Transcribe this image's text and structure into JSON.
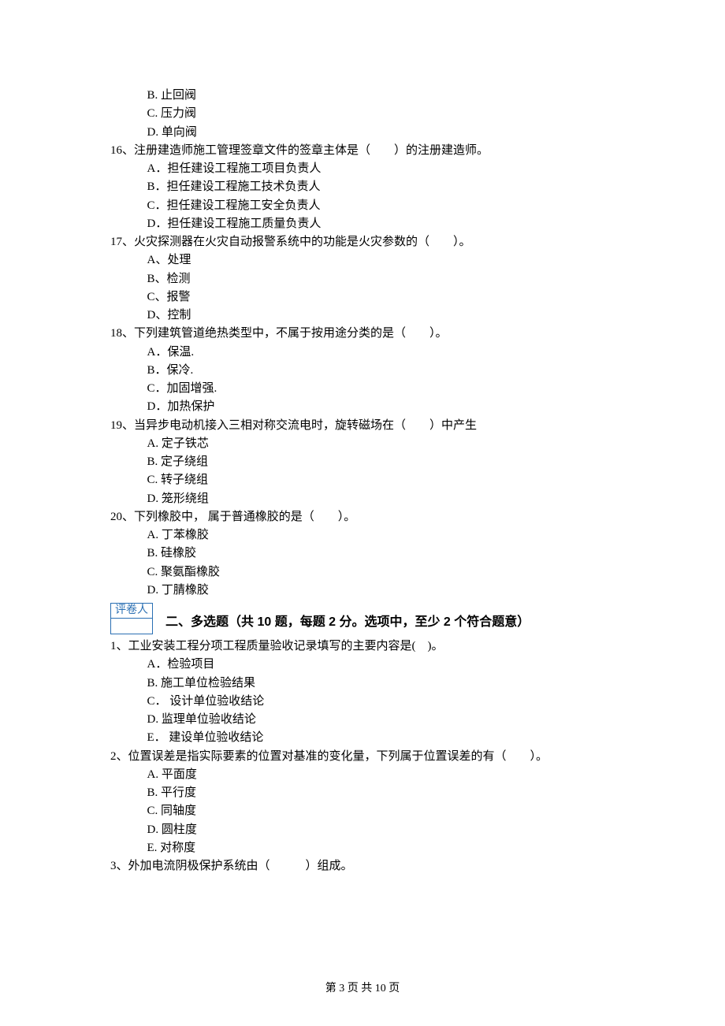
{
  "q15_remaining_options": {
    "B": "B. 止回阀",
    "C": "C. 压力阀",
    "D": "D. 单向阀"
  },
  "q16": {
    "stem": "16、注册建造师施工管理签章文件的签章主体是（　　）的注册建造师。",
    "A": "A．担任建设工程施工项目负责人",
    "B": "B．担任建设工程施工技术负责人",
    "C": "C．担任建设工程施工安全负责人",
    "D": "D．担任建设工程施工质量负责人"
  },
  "q17": {
    "stem": "17、火灾探测器在火灾自动报警系统中的功能是火灾参数的（　　）。",
    "A": "A、处理",
    "B": "B、检测",
    "C": "C、报警",
    "D": "D、控制"
  },
  "q18": {
    "stem": "18、下列建筑管道绝热类型中，不属于按用途分类的是（　　）。",
    "A": "A．保温.",
    "B": "B．保冷.",
    "C": "C．加固增强.",
    "D": "D．加热保护"
  },
  "q19": {
    "stem": "19、当异步电动机接入三相对称交流电时，旋转磁场在（　　）中产生",
    "A": "A. 定子铁芯",
    "B": "B. 定子绕组",
    "C": "C. 转子绕组",
    "D": "D. 笼形绕组"
  },
  "q20": {
    "stem": "20、下列橡胶中， 属于普通橡胶的是（　　）。",
    "A": "A. 丁苯橡胶",
    "B": "B. 硅橡胶",
    "C": "C. 聚氨酯橡胶",
    "D": "D. 丁腈橡胶"
  },
  "grader_label": "评卷人",
  "section2_title": "二、多选题（共 10 题，每题 2 分。选项中，至少 2 个符合题意）",
  "mq1": {
    "stem": "1、工业安装工程分项工程质量验收记录填写的主要内容是(　)。",
    "A": "A．检验项目",
    "B": "B. 施工单位检验结果",
    "C": "C． 设计单位验收结论",
    "D": "D. 监理单位验收结论",
    "E": "E． 建设单位验收结论"
  },
  "mq2": {
    "stem": "2、位置误差是指实际要素的位置对基准的变化量，下列属于位置误差的有（　　）。",
    "A": "A. 平面度",
    "B": "B. 平行度",
    "C": "C. 同轴度",
    "D": "D. 圆柱度",
    "E": "E. 对称度"
  },
  "mq3": {
    "stem": "3、外加电流阴极保护系统由（　　　）组成。"
  },
  "footer": "第 3 页 共 10 页"
}
